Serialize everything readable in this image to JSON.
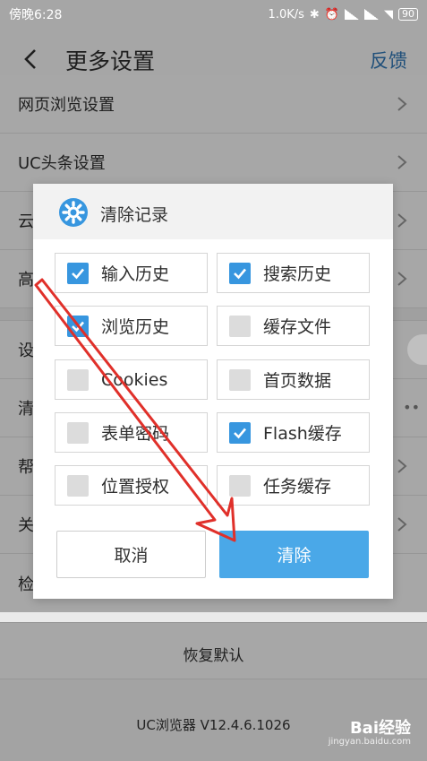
{
  "status_bar": {
    "time": "傍晚6:28",
    "speed": "1.0K/s",
    "battery": "90"
  },
  "header": {
    "title": "更多设置",
    "feedback": "反馈"
  },
  "settings": {
    "rows": [
      {
        "label": "网页浏览设置"
      },
      {
        "label": "UC头条设置"
      },
      {
        "label": "云"
      },
      {
        "label": "高"
      }
    ],
    "rows2": [
      {
        "label": "设"
      },
      {
        "label": "清"
      },
      {
        "label": "帮"
      },
      {
        "label": "关"
      },
      {
        "label": "检"
      }
    ],
    "restore_label": "恢复默认",
    "version": "UC浏览器 V12.4.6.1026"
  },
  "dialog": {
    "title": "清除记录",
    "options": [
      {
        "label": "输入历史",
        "checked": true
      },
      {
        "label": "搜索历史",
        "checked": true
      },
      {
        "label": "浏览历史",
        "checked": true
      },
      {
        "label": "缓存文件",
        "checked": false
      },
      {
        "label": "Cookies",
        "checked": false
      },
      {
        "label": "首页数据",
        "checked": false
      },
      {
        "label": "表单密码",
        "checked": false
      },
      {
        "label": "Flash缓存",
        "checked": true
      },
      {
        "label": "位置授权",
        "checked": false
      },
      {
        "label": "任务缓存",
        "checked": false
      }
    ],
    "cancel_label": "取消",
    "clear_label": "清除"
  },
  "watermark": {
    "brand": "Bai经验",
    "url": "jingyan.baidu.com"
  },
  "colors": {
    "accent": "#4aa8e8",
    "checkbox_on": "#3796df",
    "annotation": "#e0302a"
  }
}
